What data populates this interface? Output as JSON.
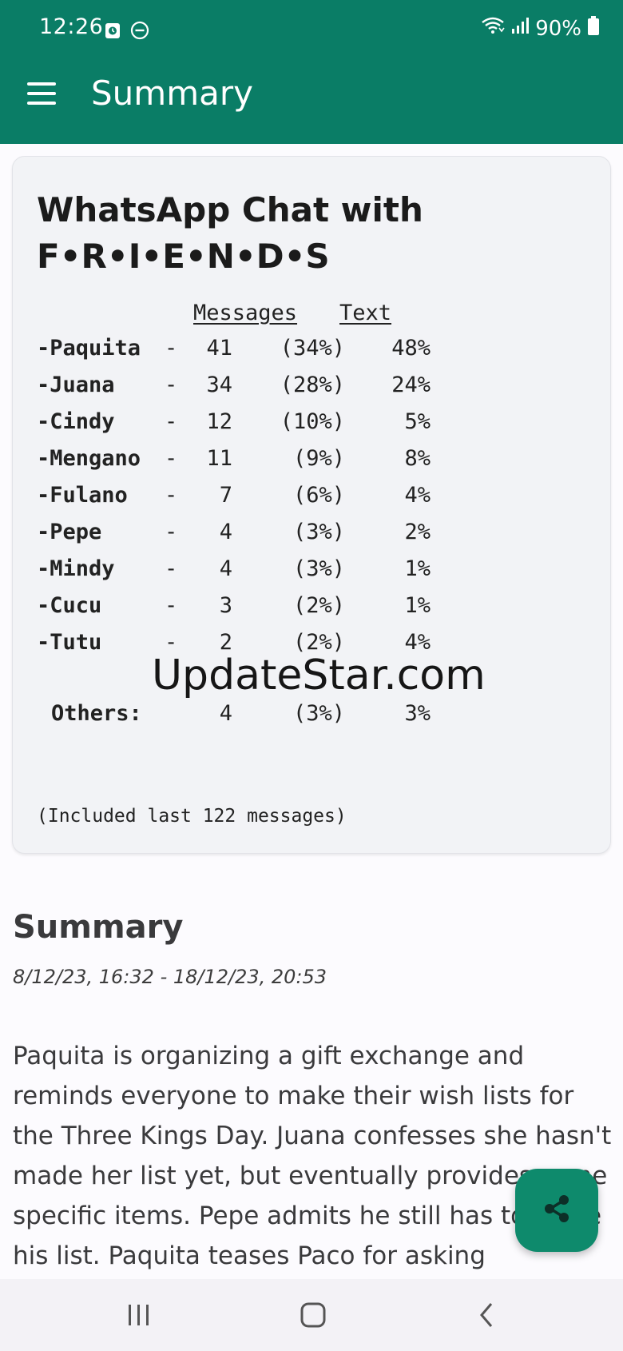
{
  "status_bar": {
    "time": "12:26",
    "battery": "90%",
    "icons": [
      "alarm-icon",
      "do-not-disturb-icon",
      "wifi-icon",
      "signal-icon",
      "battery-icon"
    ]
  },
  "app_bar": {
    "title": "Summary",
    "menu_icon": "hamburger-menu-icon"
  },
  "card": {
    "title_line1": "WhatsApp Chat with",
    "title_line2": "F•R•I•E•N•D•S",
    "header_messages": "Messages",
    "header_text": "Text",
    "rows": [
      {
        "name": "-Paquita",
        "dash": "-",
        "count": "41",
        "pct": "(34%)",
        "text": "48%"
      },
      {
        "name": "-Juana",
        "dash": "-",
        "count": "34",
        "pct": "(28%)",
        "text": "24%"
      },
      {
        "name": "-Cindy",
        "dash": "-",
        "count": "12",
        "pct": "(10%)",
        "text": "5%"
      },
      {
        "name": "-Mengano",
        "dash": "-",
        "count": "11",
        "pct": "(9%)",
        "text": "8%"
      },
      {
        "name": "-Fulano",
        "dash": "-",
        "count": "7",
        "pct": "(6%)",
        "text": "4%"
      },
      {
        "name": "-Pepe",
        "dash": "-",
        "count": "4",
        "pct": "(3%)",
        "text": "2%"
      },
      {
        "name": "-Mindy",
        "dash": "-",
        "count": "4",
        "pct": "(3%)",
        "text": "1%"
      },
      {
        "name": "-Cucu",
        "dash": "-",
        "count": "3",
        "pct": "(2%)",
        "text": "1%"
      },
      {
        "name": "-Tutu",
        "dash": "-",
        "count": "2",
        "pct": "(2%)",
        "text": "4%"
      }
    ],
    "others": {
      "name": "Others:",
      "count": "4",
      "pct": "(3%)",
      "text": "3%"
    },
    "footnote": "(Included last 122 messages)"
  },
  "watermark": "UpdateStar.com",
  "summary": {
    "heading": "Summary",
    "date_range": "8/12/23, 16:32 - 18/12/23, 20:53",
    "body": "Paquita is organizing a gift exchange and reminds everyone to make their wish lists for the Three Kings Day. Juana confesses she hasn't made her list yet, but eventually provides some specific items. Pepe admits he still has to make his list. Paquita teases Paco for asking"
  },
  "fab": {
    "icon": "share-icon"
  },
  "nav_bar": {
    "icons": [
      "recent-apps-icon",
      "home-icon",
      "back-icon"
    ]
  },
  "colors": {
    "primary": "#0a7d66",
    "fab": "#0e8a6c",
    "card_bg": "#f2f3f6",
    "page_bg": "#fcfbfe"
  }
}
